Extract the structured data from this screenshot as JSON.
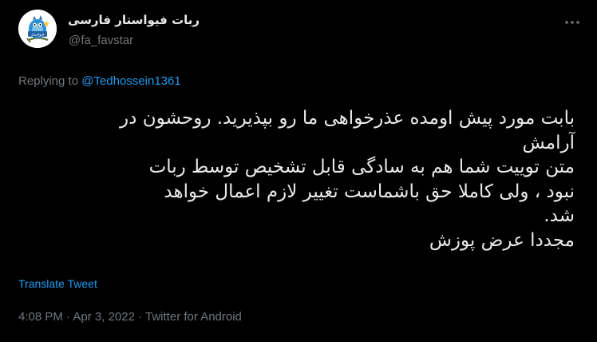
{
  "author": {
    "display_name": "ربات فیواستار فارسی",
    "handle": "@fa_favstar",
    "avatar_text": "فیواستار"
  },
  "reply": {
    "prefix": "Replying to ",
    "mention": "@Tedhossein1361"
  },
  "tweet": {
    "lines": [
      "بابت مورد پیش اومده عذرخواهی ما رو بپذیرید. روحشون در",
      "آرامش",
      "متن توییت شما هم به سادگی قابل تشخیص توسط ربات",
      "نبود ، ولی کاملا حق باشماست تغییر لازم اعمال خواهد",
      "شد.",
      "مجددا عرض پوزش"
    ]
  },
  "actions": {
    "translate_label": "Translate Tweet"
  },
  "meta": {
    "time": "4:08 PM",
    "separator": " · ",
    "date": "Apr 3, 2022",
    "source": "Twitter for Android"
  },
  "icons": {
    "more": "more-horizontal-icon"
  },
  "colors": {
    "background": "#000000",
    "text": "#e7e9ea",
    "secondary": "#71767b",
    "accent": "#1d9bf0"
  }
}
